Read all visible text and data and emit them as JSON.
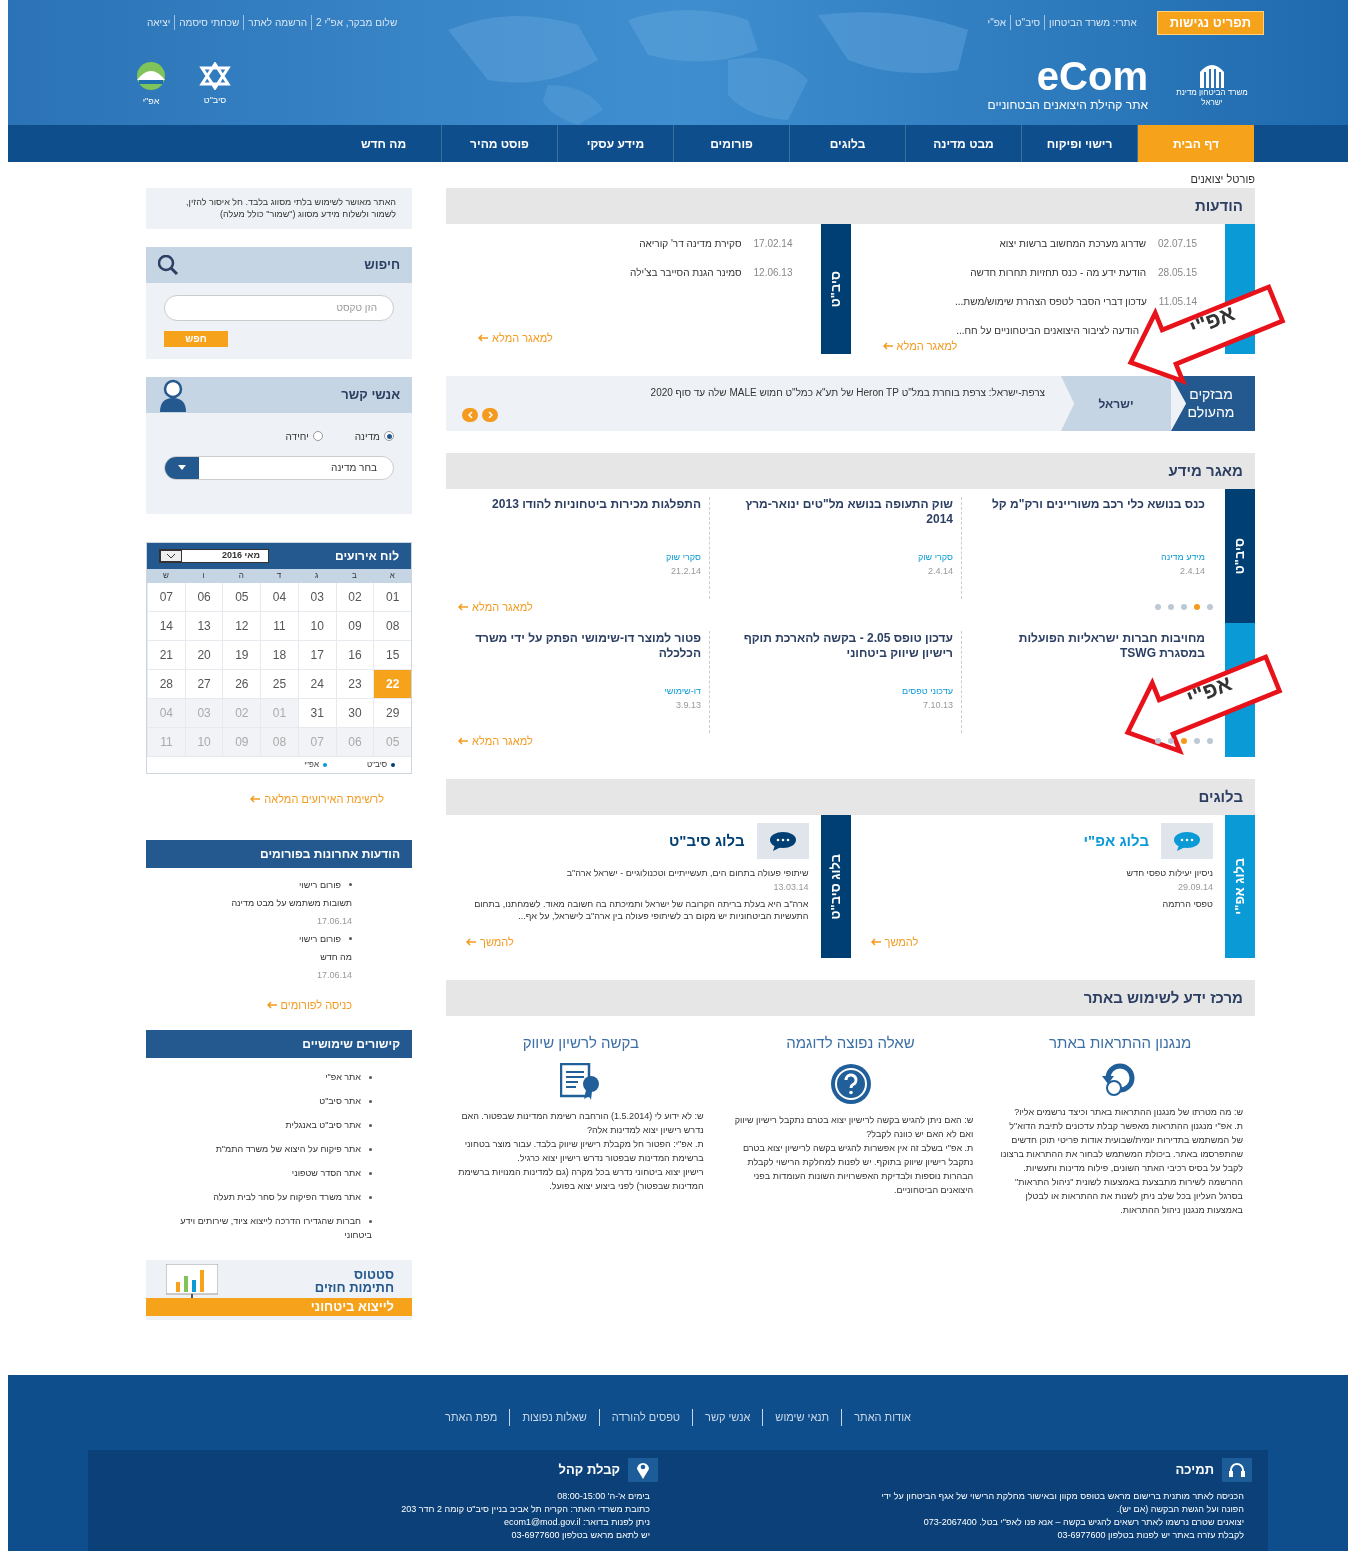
{
  "top_bar": {
    "accessibility_button": "תפריט נגישות",
    "sites_links": [
      "אתרי: משרד הביטחון",
      "סיב\"ט",
      "אפ\"י"
    ],
    "user_links": [
      "שלום מבקר, אפ\"י 2",
      "הרשמה לאתר",
      "שכחתי סיסמה",
      "יציאה"
    ]
  },
  "header": {
    "ministry": "משרד הביטחון מדינת ישראל",
    "logo": "eCom",
    "tagline": "אתר קהילת היצואנים הבטחוניים",
    "partner_logos": [
      {
        "label": "סיב\"ט",
        "kind": "star"
      },
      {
        "label": "אפ\"י",
        "kind": "dome"
      }
    ]
  },
  "nav": [
    {
      "label": "דף הבית",
      "selected": true
    },
    {
      "label": "רישוי ופיקוח",
      "selected": false
    },
    {
      "label": "מבט מדינה",
      "selected": false
    },
    {
      "label": "בלוגים",
      "selected": false
    },
    {
      "label": "פורומים",
      "selected": false
    },
    {
      "label": "מידע עסקי",
      "selected": false
    },
    {
      "label": "פוסט מהיר",
      "selected": false
    },
    {
      "label": "מה חדש",
      "selected": false
    }
  ],
  "breadcrumb": "פורטל יצואנים",
  "announcements": {
    "title": "הודעות",
    "columns": [
      {
        "color": "#0a9ad6",
        "more": "למאגר המלא",
        "items": [
          {
            "date": "02.07.15",
            "text": "שדרוג מערכת המחשוב ברשות יצוא"
          },
          {
            "date": "28.05.15",
            "text": "הודעת ידע מה - כנס תחזיות תחרות חדשה"
          },
          {
            "date": "11.05.14",
            "text": "עדכון דברי הסבר לטפס הצהרת שימוש/משת..."
          },
          {
            "text": "הודעה לציבור היצואנים הביטחוניים על חח..."
          }
        ]
      },
      {
        "tab": "סיב\"ט",
        "color": "#003f73",
        "more": "למאגר המלא",
        "items": [
          {
            "date": "17.02.14",
            "text": "סקירת מדינה דר' קוריאה"
          },
          {
            "date": "12.06.13",
            "text": "סמינר הגנת הסייבר בצ'ילה"
          }
        ]
      }
    ]
  },
  "ticker": {
    "badge": "מבזקים מהעולם",
    "region": "ישראל",
    "text": "צרפת-ישראל: צרפת בוחרת במל\"ט Heron TP של תע\"א כמל\"ט חמוש MALE שלה עד סוף 2020"
  },
  "knowledge_base": {
    "title": "מאגר מידע",
    "rows": [
      {
        "tab": "סיב\"ט",
        "color": "#003f73",
        "more": "למאגר המלא",
        "items": [
          {
            "title": "כנס בנושא כלי רכב משוריינים ורק\"מ קל",
            "category": "מידע מדינה",
            "date": "2.4.14"
          },
          {
            "title": "שוק התעופה בנושא מל\"טים ינואר-מרץ 2014",
            "category": "סקרי שוק",
            "date": "2.4.14"
          },
          {
            "title": "התפלגות מכירות ביטחוניות להודו 2013",
            "category": "סקרי שוק",
            "date": "21.2.14"
          }
        ],
        "dots": [
          {
            "selected": false
          },
          {
            "selected": true
          },
          {
            "selected": false
          },
          {
            "selected": false
          },
          {
            "selected": false
          }
        ]
      },
      {
        "color": "#0a9ad6",
        "more": "למאגר המלא",
        "items": [
          {
            "title": "מחויבות חברות ישראליות הפועלות במסגרת TSWG"
          },
          {
            "title": "עדכון טופס 2.05 - בקשה להארכת תוקף רישיון שיווק ביטחוני",
            "category": "עדכוני טפסים",
            "date": "7.10.13"
          },
          {
            "title": "פטור למוצר דו-שימושי הפתק על ידי משרד הכלכלה",
            "category": "דו-שימושי",
            "date": "3.9.13"
          }
        ],
        "dots": [
          {
            "selected": false
          },
          {
            "selected": false
          },
          {
            "selected": true
          },
          {
            "selected": false
          },
          {
            "selected": false
          }
        ]
      }
    ]
  },
  "blogs": {
    "title": "בלוגים",
    "columns": [
      {
        "tab": "בלוג אפ\"י",
        "color": "#0a9ad6",
        "title": "בלוג אפ\"י",
        "subtitle": "ניסיון יעילות טפסי חדש",
        "date": "29.09.14",
        "body": "טפסי הרתמה",
        "more": "להמשך"
      },
      {
        "tab": "בלוג סיב\"ט",
        "color": "#003f73",
        "title": "בלוג סיב\"ט",
        "subtitle": "שיתופי פעולה בתחום הים, תעשייתיים וטכנולוגיים - ישראל ארה\"ב",
        "date": "13.03.14",
        "body": "ארה\"ב היא בעלת בריתה הקרובה של ישראל ותמיכתה בה חשובה מאוד. לשמחתנו, בתחום התעשיות הביטחוניות יש מקום רב לשיתופי פעולה בין ארה\"ב לישראל, על אף...",
        "more": "להמשך"
      }
    ]
  },
  "help_center": {
    "title": "מרכז ידע לשימוש באתר",
    "columns": [
      {
        "title": "מנגנון ההתראות באתר",
        "kind": "alerts",
        "paragraphs": [
          "ש: מה מטרתו של מנגנון ההתראות באתר וכיצד נרשמים אליו?",
          "ת. אפ\"י מנגנון ההתראות מאפשר קבלת עדכונים לתיבת הדוא\"ל של המשתמש בתדירות יומית/שבועית אודות פריטי תוכן חדשים שהתפרסמו באתר. ביכולת המשתמש לבחור את ההתראות ברצונו לקבל על בסיס רכיבי האתר השונים, פילוח מדינות ותעשיות. ההרשמה לשירות מתבצעת באמצעות לשונית \"ניהול התראות\" בסרגל העליון בכל שלב ניתן לשנות את ההתראות או לבטלן באמצעות מנגנון ניהול ההתראות."
        ]
      },
      {
        "title": "שאלה נפוצה לדוגמה",
        "kind": "faq",
        "paragraphs": [
          "ש: האם ניתן להגיש בקשה לרישיון יצוא בטרם נתקבל רישיון שיווק ואם לא האם יש כוונה לקבל?",
          "ת. אפ\"י בשלב זה אין אפשרות להגיש בקשה לרישיון יצוא בטרם נתקבל רישיון שיווק בתוקף. יש לפנות למחלקת הרישוי לקבלת הבהרות נוספות ולבדיקת האפשרויות השונות העומדות בפני היצואנים הביטחוניים."
        ]
      },
      {
        "title": "בקשה לרשיון שיווק",
        "kind": "license",
        "paragraphs": [
          "ש: לא ידוע לי (1.5.2014) הורחבה רשימת המדינות שבפטור. האם נדרש רישיון יצוא למדינות אלה?",
          "ת. אפ\"י: הפטור חל מקבלת רישיון שיווק בלבד. עבור מוצר בטחוני ברשימת המדינות שבפטור נדרש רישיון יצוא כרגיל.",
          "רישיון יצוא ביטחוני נדרש בכל מקרה (גם למדינות המנויות ברשימת המדינות שבפטור) לפני ביצוע יצוא בפועל."
        ]
      }
    ]
  },
  "sidebar": {
    "notice": "האתר מאושר לשימוש בלתי מסווג בלבד. חל איסור להזין, לשמור ולשלוח מידע מסווג (\"שמור\" כולל מעלה)",
    "search": {
      "title": "חיפוש",
      "placeholder": "הזן טקסט",
      "button": "חפש"
    },
    "contacts": {
      "title": "אנשי קשר",
      "options": [
        {
          "label": "מדינה",
          "selected": true
        },
        {
          "label": "יחידה",
          "selected": false
        }
      ],
      "select_value": "בחר מדינה"
    },
    "calendar": {
      "title": "לוח אירועים",
      "month": "מאי 2016",
      "weekdays": [
        "א",
        "ב",
        "ג",
        "ד",
        "ה",
        "ו",
        "ש"
      ],
      "weeks": [
        [
          {
            "day": "01",
            "selected": false,
            "outside": false
          },
          {
            "day": "02",
            "selected": false,
            "outside": false
          },
          {
            "day": "03",
            "selected": false,
            "outside": false
          },
          {
            "day": "04",
            "selected": false,
            "outside": false
          },
          {
            "day": "05",
            "selected": false,
            "outside": false
          },
          {
            "day": "06",
            "selected": false,
            "outside": false
          },
          {
            "day": "07",
            "selected": false,
            "outside": false
          }
        ],
        [
          {
            "day": "08",
            "selected": false,
            "outside": false
          },
          {
            "day": "09",
            "selected": false,
            "outside": false
          },
          {
            "day": "10",
            "selected": false,
            "outside": false
          },
          {
            "day": "11",
            "selected": false,
            "outside": false
          },
          {
            "day": "12",
            "selected": false,
            "outside": false
          },
          {
            "day": "13",
            "selected": false,
            "outside": false
          },
          {
            "day": "14",
            "selected": false,
            "outside": false
          }
        ],
        [
          {
            "day": "15",
            "selected": false,
            "outside": false
          },
          {
            "day": "16",
            "selected": false,
            "outside": false
          },
          {
            "day": "17",
            "selected": false,
            "outside": false
          },
          {
            "day": "18",
            "selected": false,
            "outside": false
          },
          {
            "day": "19",
            "selected": false,
            "outside": false
          },
          {
            "day": "20",
            "selected": false,
            "outside": false
          },
          {
            "day": "21",
            "selected": false,
            "outside": false
          }
        ],
        [
          {
            "day": "22",
            "selected": true,
            "outside": false
          },
          {
            "day": "23",
            "selected": false,
            "outside": false
          },
          {
            "day": "24",
            "selected": false,
            "outside": false
          },
          {
            "day": "25",
            "selected": false,
            "outside": false
          },
          {
            "day": "26",
            "selected": false,
            "outside": false
          },
          {
            "day": "27",
            "selected": false,
            "outside": false
          },
          {
            "day": "28",
            "selected": false,
            "outside": false
          }
        ],
        [
          {
            "day": "29",
            "selected": false,
            "outside": false
          },
          {
            "day": "30",
            "selected": false,
            "outside": false
          },
          {
            "day": "31",
            "selected": false,
            "outside": false
          },
          {
            "day": "01",
            "selected": false,
            "outside": true
          },
          {
            "day": "02",
            "selected": false,
            "outside": true
          },
          {
            "day": "03",
            "selected": false,
            "outside": true
          },
          {
            "day": "04",
            "selected": false,
            "outside": true
          }
        ],
        [
          {
            "day": "05",
            "selected": false,
            "outside": true
          },
          {
            "day": "06",
            "selected": false,
            "outside": true
          },
          {
            "day": "07",
            "selected": false,
            "outside": true
          },
          {
            "day": "08",
            "selected": false,
            "outside": true
          },
          {
            "day": "09",
            "selected": false,
            "outside": true
          },
          {
            "day": "10",
            "selected": false,
            "outside": true
          },
          {
            "day": "11",
            "selected": false,
            "outside": true
          }
        ]
      ],
      "legend": [
        {
          "label": "סיב\"ט",
          "color": "#003f73"
        },
        {
          "label": "אפ\"י",
          "color": "#0a9ad6"
        }
      ],
      "more": "לרשימת האירועים המלאה"
    },
    "forums": {
      "title": "הודעות אחרונות בפורומים",
      "items": [
        {
          "forum": "פורום רישוי",
          "text": "תשובות משתמש על מבט מדינה",
          "date": "17.06.14"
        },
        {
          "forum": "פורום רישוי",
          "text": "מה חדש",
          "date": "17.06.14"
        }
      ],
      "more": "כניסה לפורומים"
    },
    "links": {
      "title": "קישורים שימושיים",
      "items": [
        "אתר אפ\"י",
        "אתר סיב\"ט",
        "אתר סיב\"ט באנגלית",
        "אתר פיקוח על היצוא של משרד התמ\"ת",
        "אתר הסדר שטפוני",
        "אתר משרד הפיקוח על סחר לבית תעלה",
        "חברות שהגדירו הדרכה לייצוא ציוד, שירותים וידע ביטחוני"
      ]
    },
    "banner": {
      "line1": "סטטוס",
      "line2": "חתימות חוזים",
      "line3": "לייצוא ביטחוני"
    }
  },
  "annotations": [
    {
      "label": "אפ\"י"
    },
    {
      "label": "אפ\"י"
    }
  ],
  "footer": {
    "links": [
      "אודות האתר",
      "תנאי שימוש",
      "אנשי קשר",
      "טפסים להורדה",
      "שאלות נפוצות",
      "מפת האתר"
    ],
    "boxes": [
      {
        "title": "תמיכה",
        "kind": "support",
        "lines": [
          "הכניסה לאתר מותנית ברישום מראש בטופס מקוון ובאישור מחלקת הרישוי של אגף הביטחון על ידי",
          "הפונה ועל הגשת הבקשה (אם יש).",
          "יצואנים שטרם נרשמו לאתר רשאים להגיש בקשה – אנא פנו לאפ\"י בטל. 073-2067400",
          "לקבלת עזרה באתר יש לפנות בטלפון 03-6977600"
        ]
      },
      {
        "title": "קבלת קהל",
        "kind": "location",
        "lines": [
          "בימים א'-ה' 08:00-15:00",
          "כתובת משרדי האתר: הקריה תל אביב בניין סיב\"ט קומה 2 חדר 203",
          "ניתן לפנות בדואר: ecom1@mod.gov.il",
          "יש לתאם מראש בטלפון 03-6977600"
        ]
      }
    ]
  }
}
